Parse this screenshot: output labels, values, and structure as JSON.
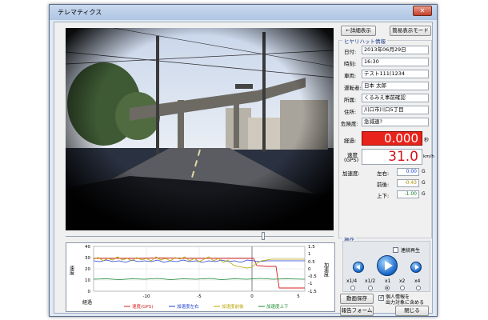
{
  "window": {
    "title": "テレマティクス",
    "close": "✕"
  },
  "buttons": {
    "detail": "←詳細表示",
    "simple_mode": "簡易表示モード",
    "save_video": "動画保存",
    "report_form": "報告フォーム",
    "close": "閉じる"
  },
  "hiyari": {
    "group_label": "ヒヤリハット情報",
    "rows": [
      {
        "label": "日付:",
        "value": "2013年06月29日"
      },
      {
        "label": "時刻:",
        "value": "16:30"
      },
      {
        "label": "車両:",
        "value": "テスト111(1234"
      },
      {
        "label": "運転者:",
        "value": "日本 太郎"
      },
      {
        "label": "所属:",
        "value": "くるみえ事前確認"
      },
      {
        "label": "住所:",
        "value": "川口市川口5丁目"
      },
      {
        "label": "危険度:",
        "value": "急減速?"
      }
    ]
  },
  "elapsed": {
    "label": "経過:",
    "value": "0.000",
    "unit": "秒"
  },
  "speed": {
    "label": "速度",
    "label2": "(GPS)",
    "value": "31.0",
    "unit": "km/h"
  },
  "accel": {
    "label": "加速度:",
    "rows": [
      {
        "label": "左右:",
        "value": "0.00",
        "unit": "G"
      },
      {
        "label": "前後:",
        "value": "-0.43",
        "unit": "G"
      },
      {
        "label": "上下:",
        "value": "-1.00",
        "unit": "G"
      }
    ]
  },
  "operation": {
    "group_label": "操作",
    "loop_label": "連続再生",
    "speeds": [
      "x1/4",
      "x1/2",
      "x1",
      "x2",
      "x4"
    ],
    "selected_speed": "x1",
    "personal_label_1": "個人情報を",
    "personal_label_2": "出力対象に含める",
    "personal_checked": true
  },
  "graph": {
    "ylabel_left": "速度",
    "ylabel_right": "加速度",
    "xlabel": "経過",
    "left_ticks": [
      "40",
      "30",
      "20",
      "10",
      "0"
    ],
    "right_ticks": [
      "1.5",
      "1",
      "0.5",
      "0",
      "-0.5",
      "-1",
      "-1.5"
    ],
    "x_ticks": [
      "-10",
      "-5",
      "0",
      "5"
    ],
    "legend": [
      {
        "name": "速度(GPS)",
        "color": "#d42020"
      },
      {
        "name": "加速度左右",
        "color": "#1f3cd0"
      },
      {
        "name": "加速度前後",
        "color": "#b8a300"
      },
      {
        "name": "加速度上下",
        "color": "#1a8a30"
      }
    ]
  }
}
